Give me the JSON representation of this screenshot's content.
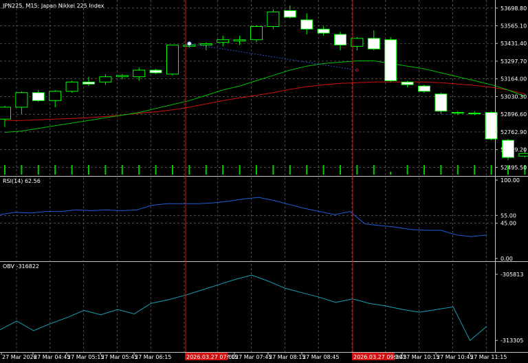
{
  "colors": {
    "background": "#000000",
    "grid": "#7a7a7a",
    "axis_text": "#ffffff",
    "candle_up_fill": "#000000",
    "candle_down_fill": "#ffffff",
    "candle_outline": "#00ff00",
    "ma_fast": "#00c000",
    "ma_slow": "#d01010",
    "volume": "#00cc00",
    "rsi": "#1e5fd8",
    "obv": "#19a0b4",
    "vline": "#d01010",
    "vline_tag_bg": "#d01010",
    "trendline": "#3050c0"
  },
  "main": {
    "title": "JPN225, M15:  Japan Nikkei 225 Index",
    "price_ticks": [
      "53698.80",
      "53565.10",
      "53431.40",
      "53297.70",
      "53164.00",
      "53030.30",
      "52896.60",
      "52762.90",
      "52629.20",
      "52495.50"
    ],
    "vline_labels": [
      "2026.03.27 07:00",
      "2026.03.27 09:30"
    ]
  },
  "rsi": {
    "title": "RSI(14) 62.56",
    "ticks": [
      "100.00",
      "55.00",
      "45.00",
      "0.00"
    ]
  },
  "obv": {
    "title": "OBV -316822",
    "ticks": [
      "-305813",
      "-313305"
    ]
  },
  "time_axis": {
    "labels": [
      "27 Mar 2026",
      "27 Mar 04:45",
      "27 Mar 05:15",
      "27 Mar 05:45",
      "27 Mar 06:15",
      "27 Mar 07:15",
      "27 Mar 07:45",
      "27 Mar 08:15",
      "27 Mar 08:45",
      "27 Mar 09:45",
      "27 Mar 10:15",
      "27 Mar 10:45",
      "27 Mar 11:15"
    ]
  },
  "chart_data": {
    "type": "candlestick",
    "symbol": "JPN225",
    "timeframe": "M15",
    "ylim": [
      52430,
      53760
    ],
    "candles": [
      {
        "o": 52860,
        "h": 52960,
        "l": 52800,
        "c": 52950
      },
      {
        "o": 52950,
        "h": 53070,
        "l": 52900,
        "c": 53060
      },
      {
        "o": 53060,
        "h": 53080,
        "l": 52990,
        "c": 53000
      },
      {
        "o": 53000,
        "h": 53080,
        "l": 52950,
        "c": 53070
      },
      {
        "o": 53070,
        "h": 53150,
        "l": 53060,
        "c": 53140
      },
      {
        "o": 53140,
        "h": 53180,
        "l": 53110,
        "c": 53125
      },
      {
        "o": 53140,
        "h": 53200,
        "l": 53120,
        "c": 53180
      },
      {
        "o": 53180,
        "h": 53200,
        "l": 53160,
        "c": 53190
      },
      {
        "o": 53180,
        "h": 53250,
        "l": 53150,
        "c": 53230
      },
      {
        "o": 53230,
        "h": 53240,
        "l": 53200,
        "c": 53210
      },
      {
        "o": 53200,
        "h": 53420,
        "l": 53190,
        "c": 53420
      },
      {
        "o": 53410,
        "h": 53430,
        "l": 53400,
        "c": 53420
      },
      {
        "o": 53420,
        "h": 53440,
        "l": 53380,
        "c": 53430
      },
      {
        "o": 53440,
        "h": 53490,
        "l": 53410,
        "c": 53460
      },
      {
        "o": 53450,
        "h": 53490,
        "l": 53420,
        "c": 53460
      },
      {
        "o": 53460,
        "h": 53570,
        "l": 53440,
        "c": 53560
      },
      {
        "o": 53560,
        "h": 53690,
        "l": 53540,
        "c": 53670
      },
      {
        "o": 53680,
        "h": 53720,
        "l": 53620,
        "c": 53630
      },
      {
        "o": 53610,
        "h": 53660,
        "l": 53500,
        "c": 53540
      },
      {
        "o": 53540,
        "h": 53560,
        "l": 53490,
        "c": 53510
      },
      {
        "o": 53500,
        "h": 53520,
        "l": 53380,
        "c": 53420
      },
      {
        "o": 53410,
        "h": 53480,
        "l": 53380,
        "c": 53470
      },
      {
        "o": 53470,
        "h": 53530,
        "l": 53380,
        "c": 53390
      },
      {
        "o": 53460,
        "h": 53480,
        "l": 53140,
        "c": 53150
      },
      {
        "o": 53140,
        "h": 53150,
        "l": 53100,
        "c": 53120
      },
      {
        "o": 53110,
        "h": 53120,
        "l": 53060,
        "c": 53070
      },
      {
        "o": 53050,
        "h": 53060,
        "l": 52900,
        "c": 52920
      },
      {
        "o": 52910,
        "h": 52920,
        "l": 52890,
        "c": 52905
      },
      {
        "o": 52900,
        "h": 52920,
        "l": 52890,
        "c": 52905
      },
      {
        "o": 52910,
        "h": 52920,
        "l": 52700,
        "c": 52710
      },
      {
        "o": 52700,
        "h": 52710,
        "l": 52550,
        "c": 52570
      },
      {
        "o": 52580,
        "h": 52640,
        "l": 52570,
        "c": 52600
      }
    ],
    "ma_fast": [
      52760,
      52770,
      52790,
      52810,
      52830,
      52850,
      52870,
      52890,
      52910,
      52940,
      52970,
      53000,
      53040,
      53080,
      53110,
      53150,
      53190,
      53230,
      53260,
      53280,
      53290,
      53300,
      53300,
      53280,
      53260,
      53240,
      53210,
      53180,
      53150,
      53120,
      53080,
      53030
    ],
    "ma_slow": [
      52850,
      52850,
      52855,
      52860,
      52865,
      52870,
      52880,
      52890,
      52905,
      52915,
      52930,
      52950,
      52975,
      53000,
      53020,
      53040,
      53060,
      53085,
      53105,
      53120,
      53130,
      53135,
      53140,
      53140,
      53140,
      53140,
      53135,
      53125,
      53115,
      53100,
      53080,
      53050
    ],
    "volume": [
      1,
      1,
      1,
      1,
      1,
      1,
      1,
      1,
      1,
      1,
      1,
      1,
      1,
      1,
      1,
      1,
      1,
      1,
      1,
      1,
      1,
      1,
      1,
      0.3,
      1,
      1,
      1,
      1,
      1,
      1,
      1,
      1
    ],
    "rsi_ylim": [
      0,
      100
    ],
    "rsi": [
      56,
      59,
      58,
      60,
      60,
      62,
      61,
      62,
      61,
      62,
      68,
      70,
      70,
      70,
      71,
      73,
      76,
      78,
      74,
      69,
      64,
      60,
      56,
      60,
      44,
      42,
      40,
      37,
      36,
      36,
      30,
      28,
      30
    ],
    "obv_ylim": [
      -314300,
      -304800
    ],
    "obv": [
      -312100,
      -311100,
      -312200,
      -311400,
      -310700,
      -309900,
      -310400,
      -309800,
      -310300,
      -309100,
      -308700,
      -308200,
      -307600,
      -307000,
      -306400,
      -305900,
      -306600,
      -307400,
      -307900,
      -308400,
      -309000,
      -308600,
      -309100,
      -309400,
      -309800,
      -310100,
      -309800,
      -309500,
      -313300,
      -311700
    ],
    "levels_rsi": [
      55,
      45
    ]
  }
}
